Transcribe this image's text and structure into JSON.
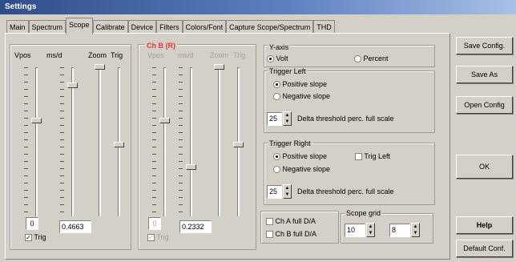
{
  "window": {
    "title": "Settings"
  },
  "tabs": [
    {
      "label": "Main"
    },
    {
      "label": "Spectrum"
    },
    {
      "label": "Scope"
    },
    {
      "label": "Calibrate"
    },
    {
      "label": "Device"
    },
    {
      "label": "Filters"
    },
    {
      "label": "Colors/Font"
    },
    {
      "label": "Capture Scope/Spectrum"
    },
    {
      "label": "THD"
    }
  ],
  "chA": {
    "title": "",
    "labels": [
      "Vpos",
      "ms/d",
      "Zoom",
      "Trig"
    ],
    "vpos_value": "0",
    "msd_value": "0.4663",
    "trig_label": "Trig",
    "trig_checked": true
  },
  "chB": {
    "title": "Ch B (R)",
    "labels": [
      "Vpos",
      "ms/d",
      "Zoom",
      "Trig"
    ],
    "vpos_value": "0",
    "msd_value": "0.2332",
    "trig_label": "Trig",
    "trig_checked": true
  },
  "yaxis": {
    "title": "Y-axis",
    "volt": "Volt",
    "percent": "Percent",
    "selected": "Volt"
  },
  "trigger_left": {
    "title": "Trigger Left",
    "positive": "Positive slope",
    "negative": "Negative slope",
    "selected": "Positive slope",
    "value": "25",
    "delta_label": "Delta threshold perc. full scale"
  },
  "trigger_right": {
    "title": "Trigger Right",
    "positive": "Positive slope",
    "negative": "Negative slope",
    "selected": "Positive slope",
    "trig_left": "Trig Left",
    "value": "25",
    "delta_label": "Delta threshold perc. full scale"
  },
  "dia": {
    "cha_label": "Ch A full D/A",
    "chb_label": "Ch B full D/A"
  },
  "scope_grid": {
    "title": "Scope grid",
    "x": "10",
    "y": "8"
  },
  "buttons": {
    "save_config": "Save Config.",
    "save_as": "Save As",
    "open_config": "Open Config",
    "ok": "OK",
    "help": "Help",
    "default_conf": "Default Conf."
  },
  "colors": {
    "title_bar": "#2f4d8a",
    "ch_a_title": "#4fbf4f",
    "ch_b_title": "#d43c3c",
    "face": "#d4d0c8"
  }
}
